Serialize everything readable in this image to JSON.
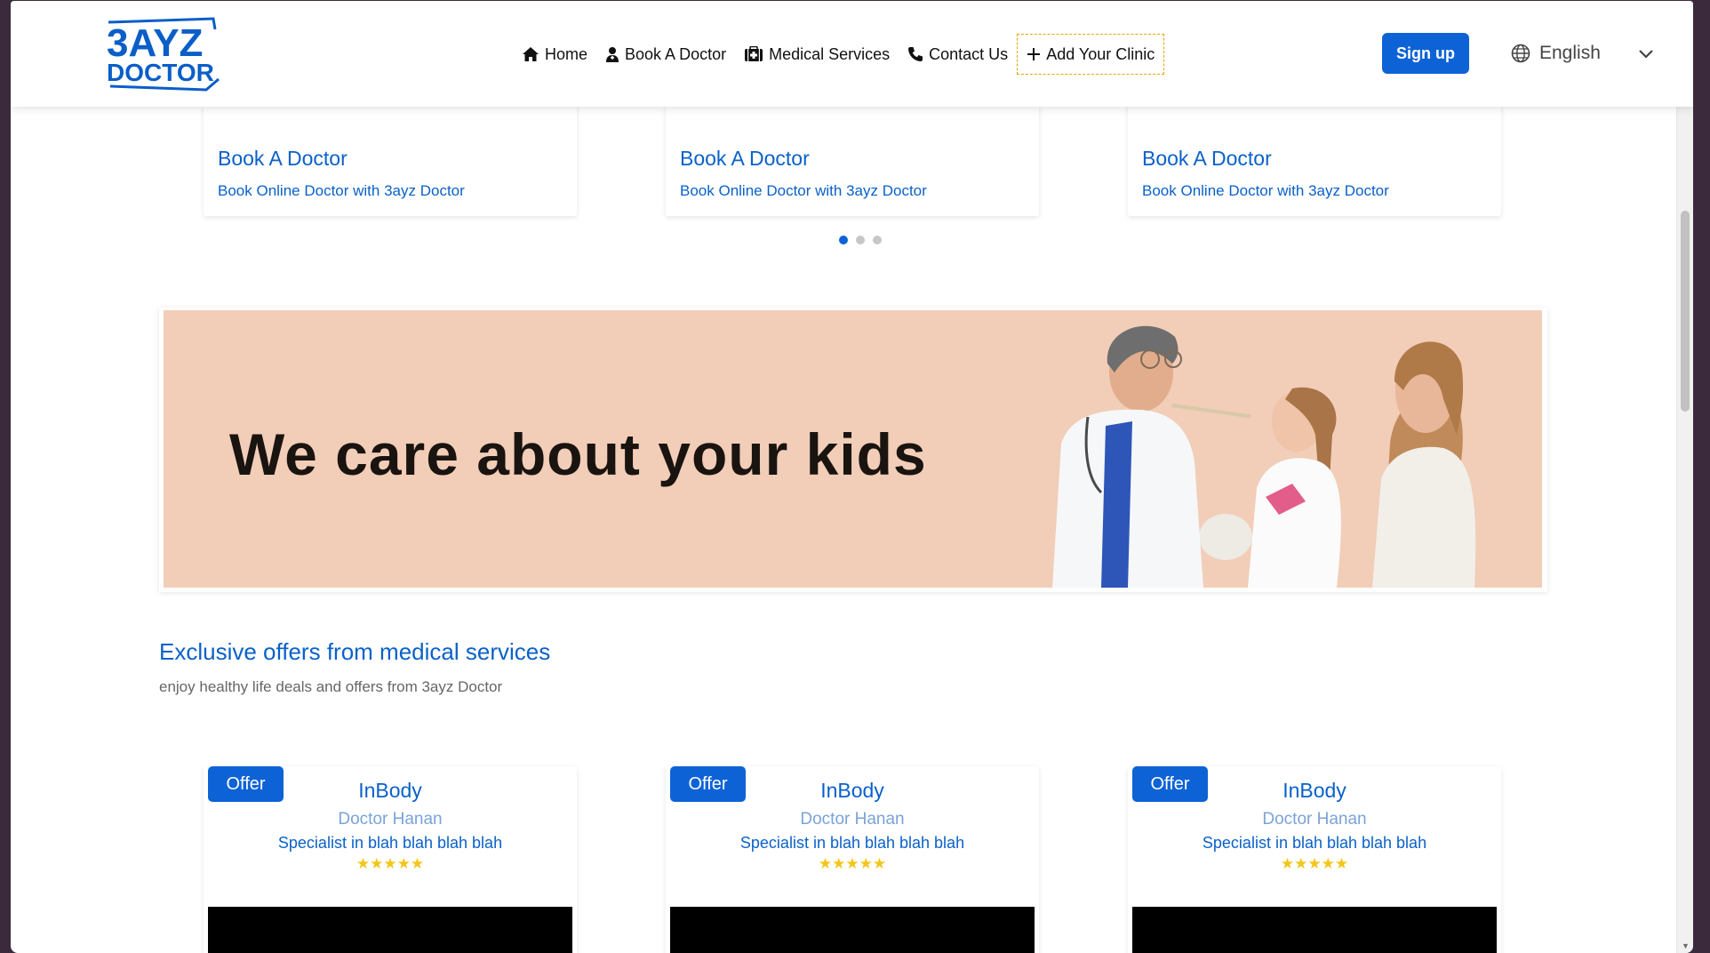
{
  "header": {
    "logo": {
      "line1": "3AYZ",
      "line2": "DOCTOR"
    },
    "nav": [
      {
        "label": "Home",
        "icon": "home-icon"
      },
      {
        "label": "Book A Doctor",
        "icon": "doctor-icon"
      },
      {
        "label": "Medical Services",
        "icon": "medical-kit-icon"
      },
      {
        "label": "Contact Us",
        "icon": "phone-icon"
      },
      {
        "label": "Add Your Clinic",
        "icon": "plus-icon"
      }
    ],
    "signup_label": "Sign up",
    "language": {
      "label": "English",
      "icon": "globe-icon"
    }
  },
  "top_cards": [
    {
      "title": "Book A Doctor",
      "subtitle": "Book Online Doctor with 3ayz Doctor"
    },
    {
      "title": "Book A Doctor",
      "subtitle": "Book Online Doctor with 3ayz Doctor"
    },
    {
      "title": "Book A Doctor",
      "subtitle": "Book Online Doctor with 3ayz Doctor"
    }
  ],
  "carousel": {
    "dots": 3,
    "active": 0
  },
  "banner": {
    "text": "We care about your kids"
  },
  "offers": {
    "title": "Exclusive offers from medical services",
    "subtitle": "enjoy healthy life deals and offers from 3ayz Doctor",
    "items": [
      {
        "badge": "Offer",
        "name": "InBody",
        "doctor": "Doctor Hanan",
        "specialty": "Specialist in blah blah blah blah",
        "rating": 5
      },
      {
        "badge": "Offer",
        "name": "InBody",
        "doctor": "Doctor Hanan",
        "specialty": "Specialist in blah blah blah blah",
        "rating": 5
      },
      {
        "badge": "Offer",
        "name": "InBody",
        "doctor": "Doctor Hanan",
        "specialty": "Specialist in blah blah blah blah",
        "rating": 5
      }
    ]
  },
  "colors": {
    "brand": "#0d63d6",
    "banner_bg": "#f2cdb8",
    "star": "#f5c518"
  }
}
